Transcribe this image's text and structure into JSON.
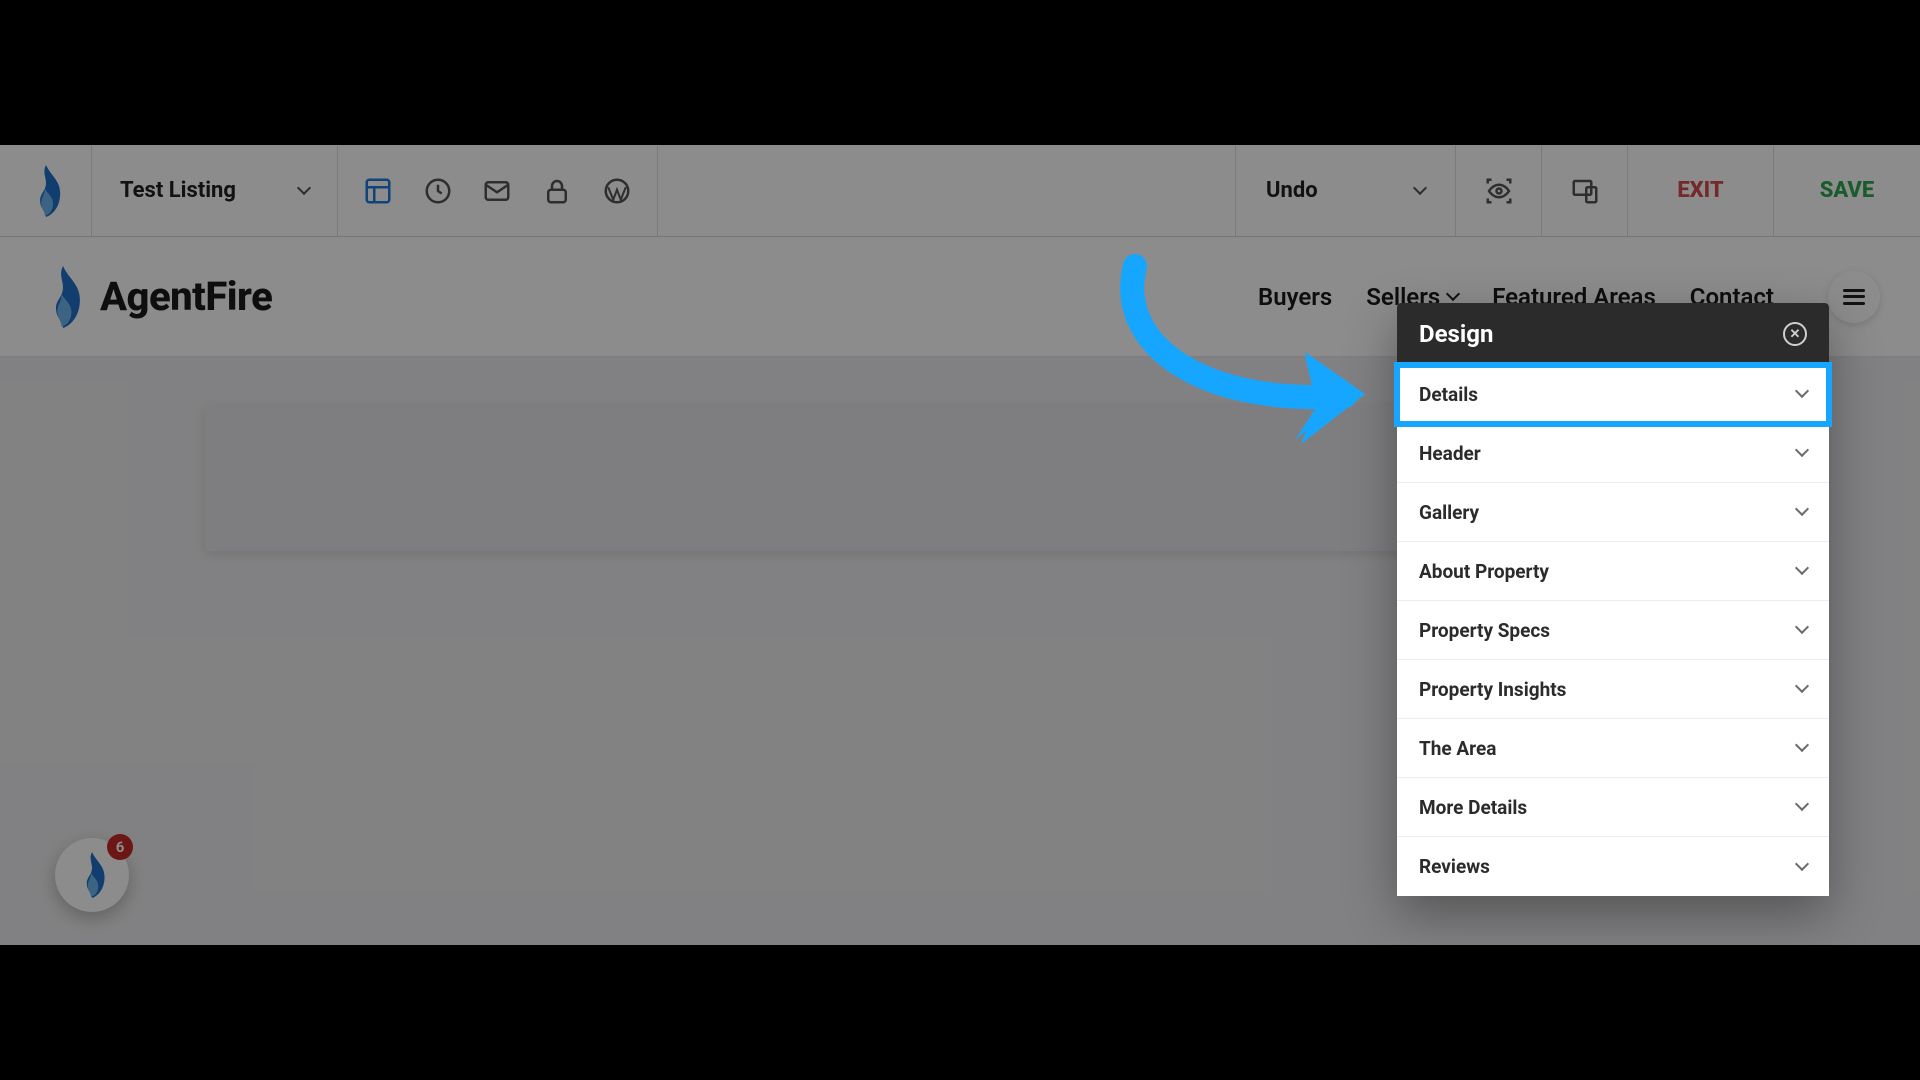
{
  "editor": {
    "page_label": "Test Listing",
    "undo_label": "Undo",
    "exit_label": "EXIT",
    "save_label": "SAVE"
  },
  "brand": {
    "name": "AgentFire"
  },
  "nav": {
    "buyers": "Buyers",
    "sellers": "Sellers",
    "featured": "Featured Areas",
    "contact": "Contact"
  },
  "panel": {
    "title": "Design",
    "rows": {
      "details": "Details",
      "header": "Header",
      "gallery": "Gallery",
      "about": "About Property",
      "specs": "Property Specs",
      "insights": "Property Insights",
      "area": "The Area",
      "more": "More Details",
      "reviews": "Reviews"
    }
  },
  "help_badge": {
    "count": "6"
  },
  "colors": {
    "highlight": "#16a6ff",
    "exit": "#d64b4b",
    "save": "#2fa84f"
  }
}
